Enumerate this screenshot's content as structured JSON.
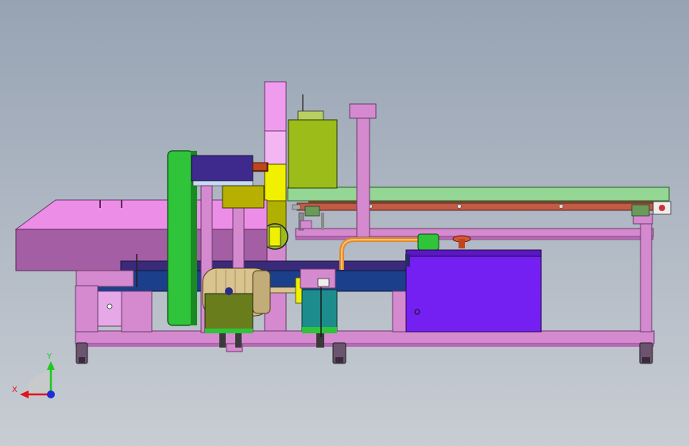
{
  "triad": {
    "x_label": "X",
    "y_label": "Y"
  },
  "colors": {
    "frame": "#d58ad0",
    "frame_dark": "#b769b5",
    "hopper_top": "#ec8ee8",
    "hopper_front": "#a45ea3",
    "conveyor_belt": "#94d693",
    "conveyor_rail": "#c35a46",
    "green_wheel": "#2fc43a",
    "yellow_green_box": "#9bbc19",
    "yellow_block": "#f0f000",
    "tank": "#7520f2",
    "tank_top": "#5a17c2",
    "motor": "#d9c48f",
    "gearbox": "#6a7d1c",
    "teal_pump": "#1c8c8c",
    "copper_pipe": "#e08a28",
    "blue_beam": "#1c3f8c",
    "dark_navy_block": "#3a2a7a",
    "caster": "#6b5470",
    "triad_x": "#e0141e",
    "triad_y": "#1ec81e",
    "triad_z": "#1e2ed2"
  }
}
